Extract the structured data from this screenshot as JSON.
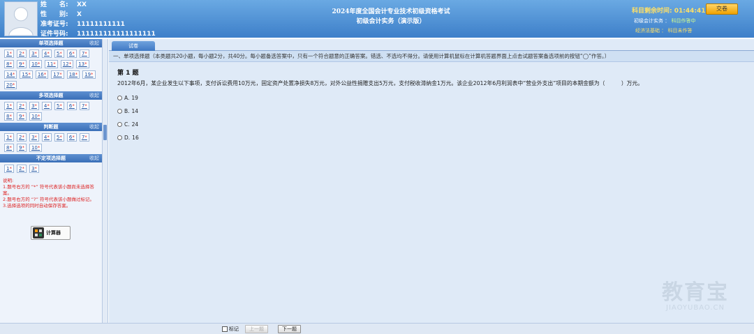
{
  "candidate": {
    "name_label": "姓　　名:",
    "name_value": "XX",
    "gender_label": "性　　别:",
    "gender_value": "X",
    "admission_label": "准考证号:",
    "admission_value": "11111111111",
    "id_label": "证件号码:",
    "id_value": "111111111111111111"
  },
  "exam": {
    "title": "2024年度全国会计专业技术初级资格考试",
    "subtitle": "初级会计实务（演示版）"
  },
  "timer": {
    "label": "科目剩余时间:",
    "value": "01:44:41"
  },
  "submit_label": "交卷",
  "subject_status": [
    {
      "subject": "初级会计实务",
      "status": "科目作答中"
    },
    {
      "subject": "经济法基础",
      "status": "科目未作答"
    }
  ],
  "sidebar": {
    "collapse_label": "收起",
    "sections": [
      {
        "title": "单项选择题",
        "numbers": [
          "1",
          "2",
          "3",
          "4",
          "5",
          "6",
          "7",
          "8",
          "9",
          "10",
          "11",
          "12",
          "13",
          "14",
          "15",
          "16",
          "17",
          "18",
          "19",
          "20"
        ]
      },
      {
        "title": "多项选择题",
        "numbers": [
          "1",
          "2",
          "3",
          "4",
          "5",
          "6",
          "7",
          "8",
          "9",
          "10"
        ]
      },
      {
        "title": "判断题",
        "numbers": [
          "1",
          "2",
          "3",
          "4",
          "5",
          "6",
          "7",
          "8",
          "9",
          "10"
        ]
      },
      {
        "title": "不定项选择题",
        "numbers": [
          "1",
          "2",
          "3"
        ]
      }
    ],
    "unanswered_marker": "*",
    "notes": {
      "heading": "说明:",
      "line1": "1.题号右方的 “*” 符号代表该小题尚未选择答案。",
      "line2": "2.题号右方的 “?” 符号代表该小题做过标记。",
      "line3": "3.选择选项的同时自动保存答案。"
    },
    "calculator_label": "计算器"
  },
  "main": {
    "tab_label": "试卷",
    "instruction": "一、单项选择题（本类题共20小题，每小题2分，共40分。每小题备选答案中，只有一个符合题意的正确答案。错选、不选均不得分。请使用计算机鼠标在计算机答题界面上点击试题答案备选项前的按钮“◯”作答。）",
    "question": {
      "title": "第 1 题",
      "stem": "2012年6月，某企业发生以下事项，支付诉讼费用10万元，固定资产处置净损失8万元，对外公益性捐赠支出5万元，支付税收滞纳金1万元。该企业2012年6月利润表中“营业外支出”项目的本期金额为（　　　）万元。",
      "options": [
        {
          "letter": "A.",
          "value": "19"
        },
        {
          "letter": "B.",
          "value": "14"
        },
        {
          "letter": "C.",
          "value": "24"
        },
        {
          "letter": "D.",
          "value": "16"
        }
      ]
    }
  },
  "footer": {
    "mark_label": "标记",
    "prev_label": "上一题",
    "next_label": "下一题"
  },
  "watermark": {
    "text": "教育宝",
    "url": "JIAOYUBAO.CN"
  },
  "colors": {
    "header_blue": "#3d7fc9",
    "timer_yellow": "#ffe066",
    "note_red": "#d22"
  }
}
